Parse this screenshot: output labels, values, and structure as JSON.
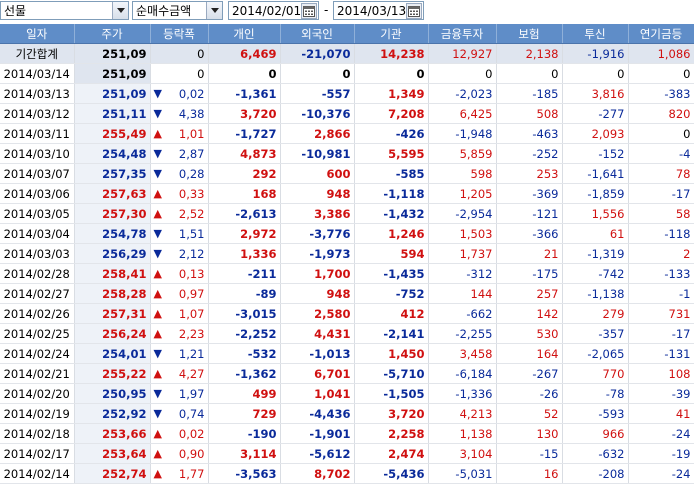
{
  "toolbar": {
    "market_select": "선물",
    "metric_select": "순매수금액",
    "date_from": "2014/02/01",
    "date_to": "2014/03/13",
    "date_separator": "-"
  },
  "table": {
    "headers": [
      "일자",
      "주가",
      "등락폭",
      "개인",
      "외국인",
      "기관",
      "금융투자",
      "보험",
      "투신",
      "연기금등"
    ],
    "total": {
      "date": "기간합계",
      "price": "251,09",
      "change": "0",
      "dir": "",
      "individual": "6,469",
      "foreign": "-21,070",
      "institution": "14,238",
      "fin_invest": "12,927",
      "insurance": "2,138",
      "trust": "-1,916",
      "pension": "1,086"
    },
    "rows": [
      {
        "date": "2014/03/14",
        "price": "251,09",
        "change": "0",
        "dir": "",
        "individual": "0",
        "foreign": "0",
        "institution": "0",
        "fin_invest": "0",
        "insurance": "0",
        "trust": "0",
        "pension": "0"
      },
      {
        "date": "2014/03/13",
        "price": "251,09",
        "change": "0,02",
        "dir": "down",
        "individual": "-1,361",
        "foreign": "-557",
        "institution": "1,349",
        "fin_invest": "-2,023",
        "insurance": "-185",
        "trust": "3,816",
        "pension": "-383"
      },
      {
        "date": "2014/03/12",
        "price": "251,11",
        "change": "4,38",
        "dir": "down",
        "individual": "3,720",
        "foreign": "-10,376",
        "institution": "7,208",
        "fin_invest": "6,425",
        "insurance": "508",
        "trust": "-277",
        "pension": "820"
      },
      {
        "date": "2014/03/11",
        "price": "255,49",
        "change": "1,01",
        "dir": "up",
        "individual": "-1,727",
        "foreign": "2,866",
        "institution": "-426",
        "fin_invest": "-1,948",
        "insurance": "-463",
        "trust": "2,093",
        "pension": "0"
      },
      {
        "date": "2014/03/10",
        "price": "254,48",
        "change": "2,87",
        "dir": "down",
        "individual": "4,873",
        "foreign": "-10,981",
        "institution": "5,595",
        "fin_invest": "5,859",
        "insurance": "-252",
        "trust": "-152",
        "pension": "-4"
      },
      {
        "date": "2014/03/07",
        "price": "257,35",
        "change": "0,28",
        "dir": "down",
        "individual": "292",
        "foreign": "600",
        "institution": "-585",
        "fin_invest": "598",
        "insurance": "253",
        "trust": "-1,641",
        "pension": "78"
      },
      {
        "date": "2014/03/06",
        "price": "257,63",
        "change": "0,33",
        "dir": "up",
        "individual": "168",
        "foreign": "948",
        "institution": "-1,118",
        "fin_invest": "1,205",
        "insurance": "-369",
        "trust": "-1,859",
        "pension": "-17"
      },
      {
        "date": "2014/03/05",
        "price": "257,30",
        "change": "2,52",
        "dir": "up",
        "individual": "-2,613",
        "foreign": "3,386",
        "institution": "-1,432",
        "fin_invest": "-2,954",
        "insurance": "-121",
        "trust": "1,556",
        "pension": "58"
      },
      {
        "date": "2014/03/04",
        "price": "254,78",
        "change": "1,51",
        "dir": "down",
        "individual": "2,972",
        "foreign": "-3,776",
        "institution": "1,246",
        "fin_invest": "1,503",
        "insurance": "-366",
        "trust": "61",
        "pension": "-118"
      },
      {
        "date": "2014/03/03",
        "price": "256,29",
        "change": "2,12",
        "dir": "down",
        "individual": "1,336",
        "foreign": "-1,973",
        "institution": "594",
        "fin_invest": "1,737",
        "insurance": "21",
        "trust": "-1,319",
        "pension": "2"
      },
      {
        "date": "2014/02/28",
        "price": "258,41",
        "change": "0,13",
        "dir": "up",
        "individual": "-211",
        "foreign": "1,700",
        "institution": "-1,435",
        "fin_invest": "-312",
        "insurance": "-175",
        "trust": "-742",
        "pension": "-133"
      },
      {
        "date": "2014/02/27",
        "price": "258,28",
        "change": "0,97",
        "dir": "up",
        "individual": "-89",
        "foreign": "948",
        "institution": "-752",
        "fin_invest": "144",
        "insurance": "257",
        "trust": "-1,138",
        "pension": "-1"
      },
      {
        "date": "2014/02/26",
        "price": "257,31",
        "change": "1,07",
        "dir": "up",
        "individual": "-3,015",
        "foreign": "2,580",
        "institution": "412",
        "fin_invest": "-662",
        "insurance": "142",
        "trust": "279",
        "pension": "731"
      },
      {
        "date": "2014/02/25",
        "price": "256,24",
        "change": "2,23",
        "dir": "up",
        "individual": "-2,252",
        "foreign": "4,431",
        "institution": "-2,141",
        "fin_invest": "-2,255",
        "insurance": "530",
        "trust": "-357",
        "pension": "-17"
      },
      {
        "date": "2014/02/24",
        "price": "254,01",
        "change": "1,21",
        "dir": "down",
        "individual": "-532",
        "foreign": "-1,013",
        "institution": "1,450",
        "fin_invest": "3,458",
        "insurance": "164",
        "trust": "-2,065",
        "pension": "-131"
      },
      {
        "date": "2014/02/21",
        "price": "255,22",
        "change": "4,27",
        "dir": "up",
        "individual": "-1,362",
        "foreign": "6,701",
        "institution": "-5,710",
        "fin_invest": "-6,184",
        "insurance": "-267",
        "trust": "770",
        "pension": "108"
      },
      {
        "date": "2014/02/20",
        "price": "250,95",
        "change": "1,97",
        "dir": "down",
        "individual": "499",
        "foreign": "1,041",
        "institution": "-1,505",
        "fin_invest": "-1,336",
        "insurance": "-26",
        "trust": "-78",
        "pension": "-39"
      },
      {
        "date": "2014/02/19",
        "price": "252,92",
        "change": "0,74",
        "dir": "down",
        "individual": "729",
        "foreign": "-4,436",
        "institution": "3,720",
        "fin_invest": "4,213",
        "insurance": "52",
        "trust": "-593",
        "pension": "41"
      },
      {
        "date": "2014/02/18",
        "price": "253,66",
        "change": "0,02",
        "dir": "up",
        "individual": "-190",
        "foreign": "-1,901",
        "institution": "2,258",
        "fin_invest": "1,138",
        "insurance": "130",
        "trust": "966",
        "pension": "-24"
      },
      {
        "date": "2014/02/17",
        "price": "253,64",
        "change": "0,90",
        "dir": "up",
        "individual": "3,114",
        "foreign": "-5,612",
        "institution": "2,474",
        "fin_invest": "3,104",
        "insurance": "-15",
        "trust": "-632",
        "pension": "-19"
      },
      {
        "date": "2014/02/14",
        "price": "252,74",
        "change": "1,77",
        "dir": "up",
        "individual": "-3,563",
        "foreign": "8,702",
        "institution": "-5,436",
        "fin_invest": "-5,031",
        "insurance": "16",
        "trust": "-208",
        "pension": "-24"
      }
    ]
  },
  "colors": {
    "header_bg": "#5f8dc8",
    "up": "#d01010",
    "down": "#0a2a9a"
  },
  "icons": {
    "dropdown": "chevron-down-icon",
    "calendar": "calendar-icon",
    "up": "up-triangle-icon",
    "down": "down-triangle-icon"
  }
}
